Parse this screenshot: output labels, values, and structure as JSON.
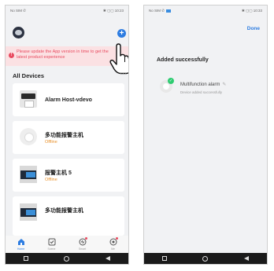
{
  "left": {
    "status_bar": {
      "carrier": "No SIM",
      "time": "10:23",
      "indicators": "✱ ▢▢ 10:23"
    },
    "banner_text": "Please update the App version in time to get the latest product experience",
    "section_title": "All Devices",
    "more": "···",
    "devices": [
      {
        "name": "Alarm Host-vdevo",
        "status": ""
      },
      {
        "name": "多功能报警主机",
        "status": "Offline"
      },
      {
        "name": "报警主机 5",
        "status": "Offline"
      },
      {
        "name": "多功能报警主机",
        "status": ""
      }
    ],
    "tabs": [
      {
        "label": "Home",
        "icon": "home-icon"
      },
      {
        "label": "Scene",
        "icon": "scene-icon"
      },
      {
        "label": "Smart",
        "icon": "smart-icon"
      },
      {
        "label": "Me",
        "icon": "me-icon"
      }
    ]
  },
  "right": {
    "status_bar": {
      "carrier": "No SIM",
      "time": "10:33",
      "indicators": "✱ ▢▢ 10:33"
    },
    "done_label": "Done",
    "success_title": "Added successfully",
    "device_name": "Multifunction alarm",
    "device_status": "Device added successfully"
  },
  "colors": {
    "accent": "#2e7de1",
    "warning": "#e84a5f",
    "offline": "#e8912b",
    "success": "#2ecc71"
  }
}
